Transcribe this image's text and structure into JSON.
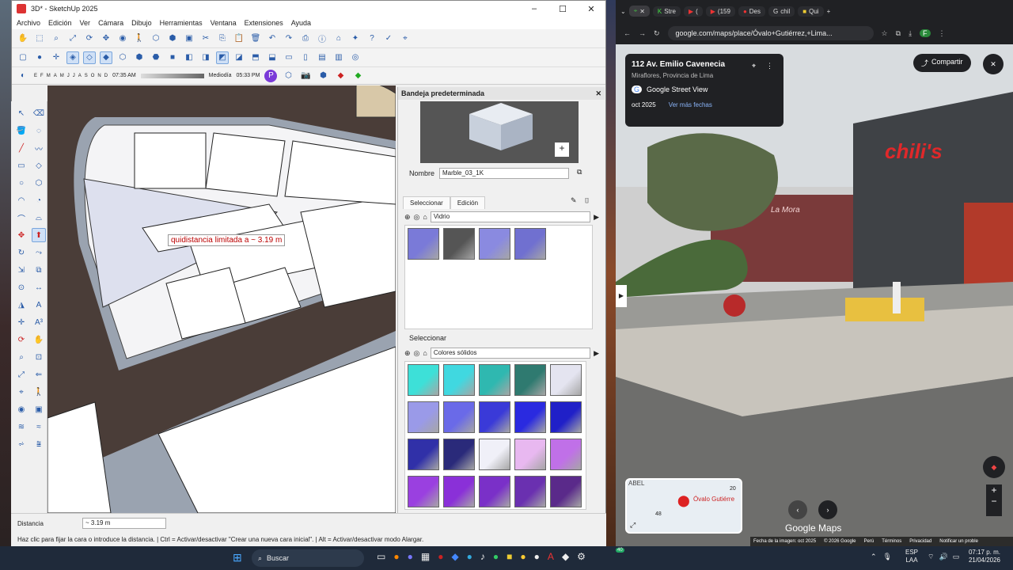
{
  "sketchup": {
    "title": "3D* - SketchUp 2025",
    "menu": [
      "Archivo",
      "Edición",
      "Ver",
      "Cámara",
      "Dibujo",
      "Herramientas",
      "Ventana",
      "Extensiones",
      "Ayuda"
    ],
    "shadow": {
      "months": [
        "E",
        "F",
        "M",
        "A",
        "M",
        "J",
        "J",
        "A",
        "S",
        "O",
        "N",
        "D"
      ],
      "time_start": "07:35 AM",
      "time_mid": "Mediodía",
      "time_end": "05:33 PM"
    },
    "tooltip": "quidistancia limitada a ~ 3.19 m",
    "tray": {
      "title": "Bandeja predeterminada",
      "name_label": "Nombre",
      "name_value": "Marble_03_1K",
      "tab_select": "Seleccionar",
      "tab_edit": "Edición",
      "library1": "Vidrio",
      "select2": "Seleccionar",
      "library2": "Colores sólidos",
      "glass_colors": [
        "#7a7ad8",
        "#555555",
        "#8a8ae0",
        "#7070d0"
      ],
      "solid_colors": [
        "#3de0d8",
        "#40d8e0",
        "#2fb8b0",
        "#2f7a70",
        "#e4e4f0",
        "#9a9ae8",
        "#6a6ae8",
        "#3a3ad8",
        "#2a2ae0",
        "#2020c8",
        "#3030a8",
        "#2a2a7a",
        "#f0f0f8",
        "#e8b8f0",
        "#c070e8",
        "#9a40e0",
        "#8a30d8",
        "#7a30c8",
        "#6a30b0",
        "#5a2a8a"
      ]
    },
    "status": {
      "distance_label": "Distancia",
      "distance_value": "~ 3.19 m",
      "hint": "Haz clic para fijar la cara o introduce la distancia.  |  Ctrl = Activar/desactivar \"Crear una nueva cara inicial\".  |  Alt = Activar/desactivar modo Alargar."
    }
  },
  "chrome": {
    "tabs": [
      "Stre",
      "(",
      "(159",
      "Des",
      "chil",
      "Qui"
    ],
    "url": "google.com/maps/place/Óvalo+Gutiérrez,+Lima...",
    "place_title": "112 Av. Emilio Cavenecia",
    "place_sub": "Miraflores, Provincia de Lima",
    "source": "Google Street View",
    "date": "oct 2025",
    "more_dates": "Ver más fechas",
    "share": "Compartir",
    "sign_text": "chili's",
    "store_sign": "La Mora",
    "map_label": "Óvalo Gutiérre",
    "map_street": "ABEL",
    "map_num1": "20",
    "map_num2": "48",
    "brand": "Google Maps",
    "footer": [
      "Fecha de la imagen: oct 2025",
      "© 2026 Google",
      "Perú",
      "Términos",
      "Privacidad",
      "Notificar un proble"
    ]
  },
  "taskbar": {
    "search": "Buscar",
    "lang1": "ESP",
    "lang2": "LAA",
    "time": "07:17 p. m.",
    "date": "21/04/2026",
    "badge": "40"
  }
}
